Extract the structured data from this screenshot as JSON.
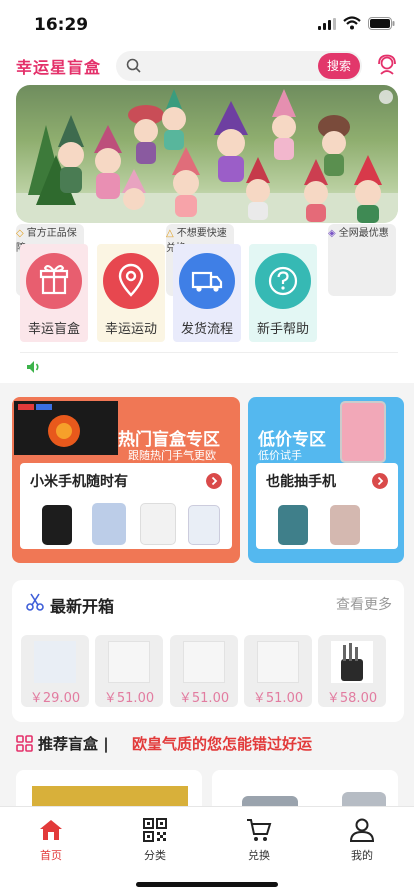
{
  "status": {
    "time": "16:29"
  },
  "header": {
    "brand": "幸运星盲盒",
    "search_button": "搜索"
  },
  "guarantees": [
    "官方正品保障",
    "不想要快速兑换",
    "全网最优惠"
  ],
  "categories": [
    {
      "label": "幸运盲盒",
      "icon": "gift-icon",
      "bg": "#fbe6ea",
      "circle": "#e85e6f"
    },
    {
      "label": "幸运运动",
      "icon": "location-pin-icon",
      "bg": "#fbf5e3",
      "circle": "#e7474f"
    },
    {
      "label": "发货流程",
      "icon": "truck-icon",
      "bg": "#e9ebfb",
      "circle": "#3f7fe6"
    },
    {
      "label": "新手帮助",
      "icon": "help-icon",
      "bg": "#e3f7f4",
      "circle": "#36b9b4"
    }
  ],
  "promo": {
    "hot": {
      "title": "热门盲盒专区",
      "subtitle": "跟随热门手气更欧",
      "product": "小米手机随时有",
      "color": "#f07755"
    },
    "cheap": {
      "title": "低价专区",
      "subtitle": "低价试手",
      "product": "也能抽手机",
      "color": "#54b8ef"
    }
  },
  "new_unbox": {
    "title": "最新开箱",
    "more": "查看更多",
    "items": [
      {
        "price": "￥29.00"
      },
      {
        "price": "￥51.00"
      },
      {
        "price": "￥51.00"
      },
      {
        "price": "￥51.00"
      },
      {
        "price": "￥58.00"
      }
    ]
  },
  "recommend": {
    "title": "推荐盲盒 |",
    "slogan": "欧皇气质的您怎能错过好运"
  },
  "tabs": [
    {
      "label": "首页",
      "icon": "home-icon"
    },
    {
      "label": "分类",
      "icon": "qr-category-icon"
    },
    {
      "label": "兑换",
      "icon": "cart-icon"
    },
    {
      "label": "我的",
      "icon": "user-icon"
    }
  ]
}
